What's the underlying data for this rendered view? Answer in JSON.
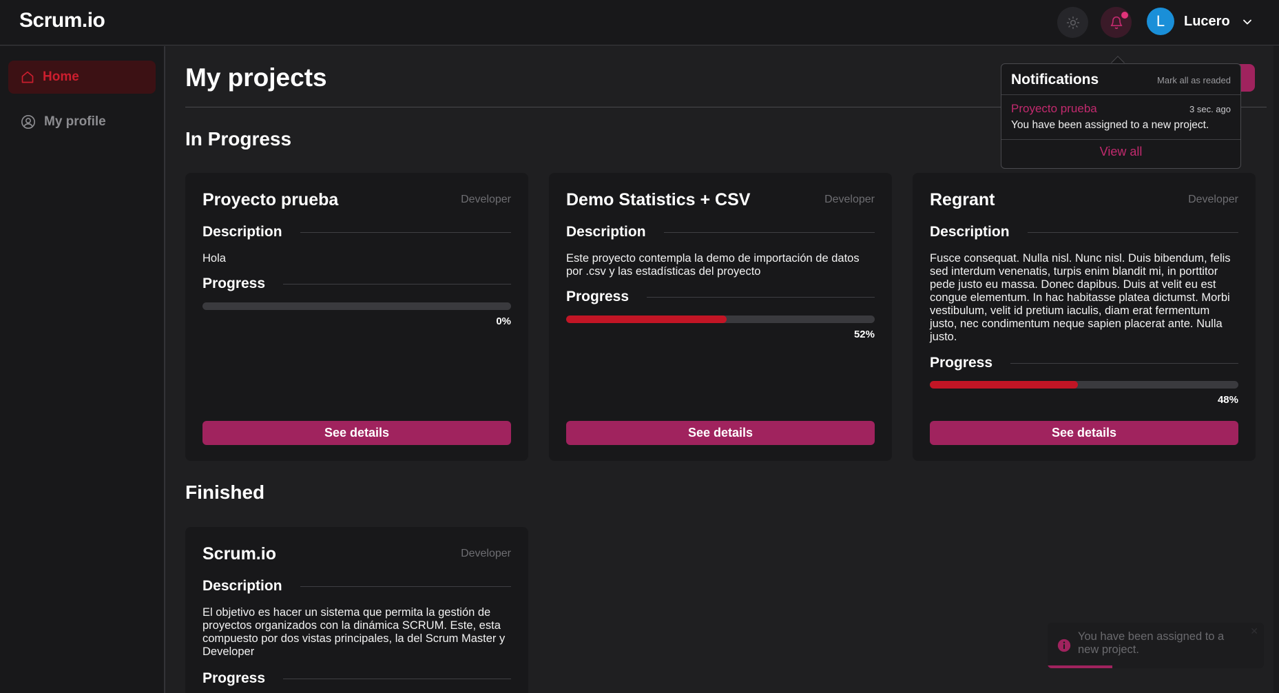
{
  "app": {
    "logo": "Scrum.io"
  },
  "header": {
    "theme_icon": "sun-icon",
    "bell_icon": "bell-icon",
    "user": {
      "initial": "L",
      "name": "Lucero",
      "avatar_color": "#1a8fd8"
    }
  },
  "sidebar": {
    "items": [
      {
        "label": "Home",
        "icon": "home-icon",
        "active": true
      },
      {
        "label": "My profile",
        "icon": "user-circle-icon",
        "active": false
      }
    ]
  },
  "main": {
    "title": "My projects",
    "sections": {
      "in_progress": "In Progress",
      "finished": "Finished"
    }
  },
  "projects": {
    "in_progress": [
      {
        "name": "Proyecto prueba",
        "role": "Developer",
        "description_label": "Description",
        "description": "Hola",
        "progress_label": "Progress",
        "progress": 0,
        "progress_text": "0%",
        "button": "See details"
      },
      {
        "name": "Demo Statistics + CSV",
        "role": "Developer",
        "description_label": "Description",
        "description": "Este proyecto contempla la demo de importación de datos por .csv y las estadísticas del proyecto",
        "progress_label": "Progress",
        "progress": 52,
        "progress_text": "52%",
        "button": "See details"
      },
      {
        "name": "Regrant",
        "role": "Developer",
        "description_label": "Description",
        "description": "Fusce consequat. Nulla nisl. Nunc nisl. Duis bibendum, felis sed interdum venenatis, turpis enim blandit mi, in porttitor pede justo eu massa. Donec dapibus. Duis at velit eu est congue elementum. In hac habitasse platea dictumst. Morbi vestibulum, velit id pretium iaculis, diam erat fermentum justo, nec condimentum neque sapien placerat ante. Nulla justo.",
        "progress_label": "Progress",
        "progress": 48,
        "progress_text": "48%",
        "button": "See details"
      }
    ],
    "finished": [
      {
        "name": "Scrum.io",
        "role": "Developer",
        "description_label": "Description",
        "description": "El objetivo es hacer un sistema que permita la gestión de proyectos organizados con la dinámica SCRUM. Este, esta compuesto por dos vistas principales, la del Scrum Master y Developer",
        "progress_label": "Progress"
      }
    ]
  },
  "notifications": {
    "title": "Notifications",
    "mark_all": "Mark all as readed",
    "items": [
      {
        "project": "Proyecto prueba",
        "time": "3 sec. ago",
        "message": "You have been assigned to a new project."
      }
    ],
    "view_all": "View all"
  },
  "toast": {
    "icon": "info-icon",
    "message": "You have been assigned to a new project.",
    "close": "✕",
    "remaining": 0.3
  },
  "colors": {
    "accent": "#a0235e",
    "progress": "#c21525",
    "active_nav": "#cc1e2e",
    "link": "#c22a6e"
  }
}
